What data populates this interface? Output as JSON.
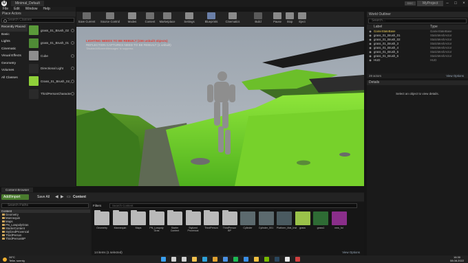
{
  "titlebar": {
    "tab": "Minimal_Default",
    "project": "MyProject",
    "badge": "DDC"
  },
  "menu": [
    "File",
    "Edit",
    "Window",
    "Help"
  ],
  "place_actors": {
    "title": "Place Actors",
    "search_placeholder": "Search Classes",
    "categories": [
      "Recently Placed",
      "Basic",
      "Lights",
      "Cinematic",
      "Visual Effects",
      "Geometry",
      "Volumes",
      "All Classes"
    ],
    "items": [
      {
        "label": "grass_01_Brush_02",
        "thumb": "#5a9a3a"
      },
      {
        "label": "grass_01_Brush_01",
        "thumb": "#4f8c36"
      },
      {
        "label": "Cube",
        "thumb": "#8d8d8d"
      },
      {
        "label": "Directional Light",
        "thumb": "#2a2a2a"
      },
      {
        "label": "Grass_01_Brush_02_M",
        "thumb": "#8fd03a"
      },
      {
        "label": "ThirdPersonCharacter",
        "thumb": "#2a2a2a"
      }
    ]
  },
  "toolbar": {
    "buttons": [
      {
        "label": "Save Current",
        "icon": "save-icon",
        "color": "#6a6a6a"
      },
      {
        "label": "Source Control",
        "icon": "source-control-icon",
        "color": "#7a7a7a"
      },
      {
        "label": "Modes",
        "icon": "modes-icon",
        "color": "#8a8a8a"
      },
      {
        "label": "Content",
        "icon": "content-icon",
        "color": "#6f6f6f"
      },
      {
        "label": "Marketplace",
        "icon": "marketplace-icon",
        "color": "#7b7b7b"
      },
      {
        "label": "Settings",
        "icon": "settings-icon",
        "color": "#8a8a8a"
      },
      {
        "label": "Blueprints",
        "icon": "blueprints-icon",
        "color": "#6a7fa8"
      },
      {
        "label": "Cinematics",
        "icon": "cinematics-icon",
        "color": "#8a8a8a"
      },
      {
        "label": "Build",
        "icon": "build-icon",
        "color": "#5a5a5a"
      },
      {
        "label": "Pause",
        "icon": "pause-icon",
        "color": "#8a8a8a"
      },
      {
        "label": "Stop",
        "icon": "stop-icon",
        "color": "#8a8a8a"
      },
      {
        "label": "Eject",
        "icon": "eject-icon",
        "color": "#8a8a8a"
      }
    ]
  },
  "viewport": {
    "warning": "LIGHTING NEEDS TO BE REBUILT (156 unbuilt objects)",
    "warning2": "REFLECTION CAPTURES NEED TO BE REBUILT (1 unbuilt)",
    "note": "'DisableAllScreenMessages' to suppress"
  },
  "outliner": {
    "title": "World Outliner",
    "search_placeholder": "Search...",
    "col_label": "Label",
    "col_type": "Type",
    "rows": [
      {
        "label": "GameStateBase",
        "type": "GameStateBase",
        "highlight": true
      },
      {
        "label": "grass_01_Brush_01",
        "type": "StaticMeshActor",
        "highlight": false
      },
      {
        "label": "grass_01_Brush_02",
        "type": "StaticMeshActor",
        "highlight": false
      },
      {
        "label": "grass_01_Brush_3",
        "type": "StaticMeshActor",
        "highlight": false
      },
      {
        "label": "grass_01_Brush_4",
        "type": "StaticMeshActor",
        "highlight": false
      },
      {
        "label": "grass_01_Brush_5",
        "type": "StaticMeshActor",
        "highlight": false
      },
      {
        "label": "grass_01_Brush_6",
        "type": "StaticMeshActor",
        "highlight": false
      },
      {
        "label": "HUD",
        "type": "HUD",
        "highlight": false
      }
    ],
    "count": "28 actors",
    "view_options": "View Options"
  },
  "details": {
    "title": "Details",
    "message": "Select an object to view details."
  },
  "content_browser": {
    "tab": "Content Browser",
    "add_import": "Add/Import",
    "save_all": "Save All",
    "breadcrumb": "Content",
    "tree_search": "Search Paths",
    "tree": [
      "Content",
      "Geometry",
      "Mannequin",
      "Maps",
      "PN_LowpolyGras",
      "StarterContent",
      "StylizedProvencal",
      "ThirdPerson",
      "ThirdPersonBP"
    ],
    "filters": "Filters",
    "search_assets": "Search Content",
    "assets": [
      {
        "name": "Geometry",
        "kind": "folder",
        "color": "#b9b9b9"
      },
      {
        "name": "Mannequin",
        "kind": "folder",
        "color": "#b9b9b9"
      },
      {
        "name": "Maps",
        "kind": "folder",
        "color": "#b9b9b9"
      },
      {
        "name": "PN_Lowpoly Gras",
        "kind": "folder",
        "color": "#b9b9b9"
      },
      {
        "name": "Starter Content",
        "kind": "folder",
        "color": "#b9b9b9"
      },
      {
        "name": "Stylized Provencal",
        "kind": "folder",
        "color": "#b9b9b9"
      },
      {
        "name": "ThirdPerson",
        "kind": "folder",
        "color": "#b9b9b9"
      },
      {
        "name": "ThirdPerson BP",
        "kind": "folder",
        "color": "#b9b9b9"
      },
      {
        "name": "Cylinder",
        "kind": "asset",
        "color": "#5c6a6e"
      },
      {
        "name": "Cylinder_001",
        "kind": "asset",
        "color": "#5c6a6e"
      },
      {
        "name": "Platform_Mat_Inst",
        "kind": "asset",
        "color": "#4a5a60"
      },
      {
        "name": "grass",
        "kind": "asset",
        "color": "#9ac24a"
      },
      {
        "name": "grass1",
        "kind": "asset",
        "color": "#2e6b34"
      },
      {
        "name": "new_fol",
        "kind": "asset",
        "color": "#8a2e8a"
      }
    ],
    "count": "14 items (1 selected)",
    "view_options": "View Options"
  },
  "taskbar": {
    "temp": "28°C",
    "weather": "Teilw. sonnig",
    "time": "16:30",
    "date": "08.08.2022",
    "icons": [
      {
        "name": "start-icon",
        "color": "#3aa0f0"
      },
      {
        "name": "search-icon",
        "color": "#d0d0d0"
      },
      {
        "name": "taskview-icon",
        "color": "#d0d0d0"
      },
      {
        "name": "explorer-icon",
        "color": "#f2c14e"
      },
      {
        "name": "edge-icon",
        "color": "#2ea0d8"
      },
      {
        "name": "chrome-icon",
        "color": "#e0a030"
      },
      {
        "name": "store-icon",
        "color": "#4a90e2"
      },
      {
        "name": "spotify-icon",
        "color": "#1db954"
      },
      {
        "name": "mail-icon",
        "color": "#3a8ee6"
      },
      {
        "name": "files-icon",
        "color": "#f0c040"
      },
      {
        "name": "nvidia-icon",
        "color": "#76b900"
      },
      {
        "name": "steam-icon",
        "color": "#2a475e"
      },
      {
        "name": "unreal-icon",
        "color": "#e8e8e8"
      },
      {
        "name": "notes-icon",
        "color": "#d04040"
      }
    ]
  }
}
